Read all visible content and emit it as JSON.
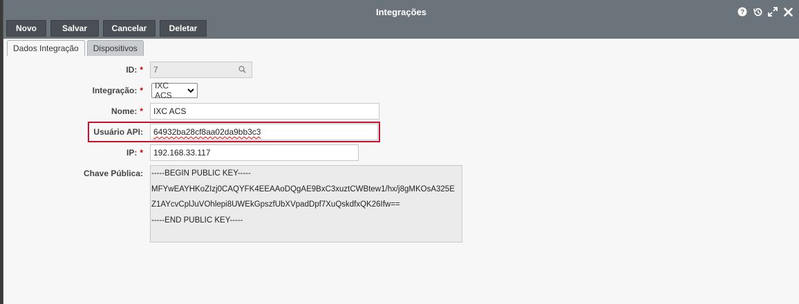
{
  "window": {
    "title": "Integrações"
  },
  "toolbar": {
    "novo": "Novo",
    "salvar": "Salvar",
    "cancelar": "Cancelar",
    "deletar": "Deletar"
  },
  "tabs": [
    {
      "label": "Dados Integração",
      "active": true
    },
    {
      "label": "Dispositivos",
      "active": false
    }
  ],
  "form": {
    "id": {
      "label": "ID:",
      "value": "7",
      "required": "*"
    },
    "integracao": {
      "label": "Integração:",
      "value": "IXC ACS",
      "required": "*"
    },
    "nome": {
      "label": "Nome:",
      "value": "IXC ACS",
      "required": "*"
    },
    "usuario_api": {
      "label": "Usuário API:",
      "value": "64932ba28cf8aa02da9bb3c3"
    },
    "ip": {
      "label": "IP:",
      "value": "192.168.33.117",
      "required": "*"
    },
    "chave_publica": {
      "label": "Chave Pública:",
      "lines": [
        "-----BEGIN PUBLIC KEY-----",
        "MFYwEAYHKoZIzj0CAQYFK4EEAAoDQgAE9BxC3xuztCWBtew1/hx/j8gMKOsA325E",
        "Z1AYcvCplJuVOhlepi8UWEkGpszfUbXVpadDpf7XuQskdfxQK26Ifw==",
        "-----END PUBLIC KEY-----"
      ]
    }
  },
  "icons": {
    "help": "help-icon",
    "history": "history-icon",
    "maximize": "maximize-icon",
    "close": "close-icon"
  },
  "colors": {
    "titlebar": "#6b737b",
    "button": "#4a4f55",
    "required": "#cc0000",
    "highlight": "#c8102e"
  }
}
